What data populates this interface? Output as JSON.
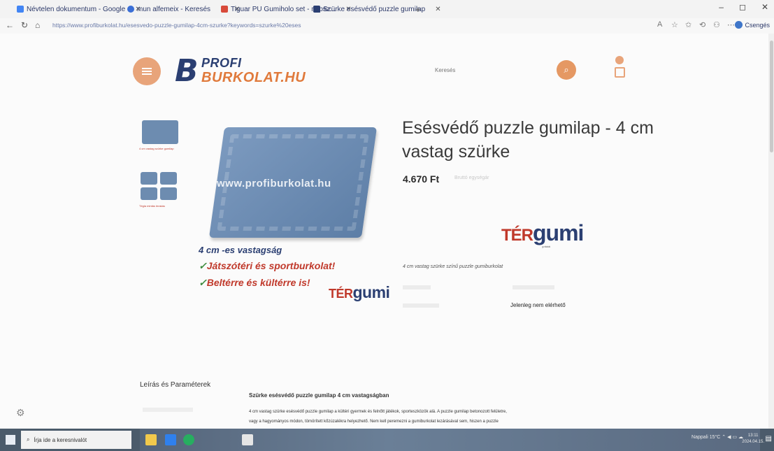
{
  "browser": {
    "tabs": [
      {
        "title": "Névtelen dokumentum - Google",
        "color": "#4285f4"
      },
      {
        "title": "mun alfemeix - Keresés",
        "color": "#3b6fd6"
      },
      {
        "title": "Tiguar PU Gumiholo set - népsz...",
        "color": "#d84a3a"
      },
      {
        "title": "Szürke esésvédő puzzle gumilap",
        "color": "#2b3f72"
      }
    ],
    "new_tab": "+",
    "url": "https://www.profiburkolat.hu/esesvedo-puzzle-gumilap-4cm-szurke?keywords=szurke%20eses",
    "profile_label": "Csengés"
  },
  "site": {
    "logo_line1": "PROFI",
    "logo_line2": "BURKOLAT.HU",
    "search_placeholder": "Keresés"
  },
  "product": {
    "title": "Esésvédő puzzle gumilap - 4 cm vastag szürke",
    "price": "4.670 Ft",
    "price_note": "Bruttó egységár",
    "image_watermark": "www.profiburkolat.hu",
    "image_thickness": "4 cm -es vastagság",
    "image_line1": "Játszótéri és sportburkolat!",
    "image_line2": "Beltérre és kültérre is!",
    "brand_ter": "TÉR",
    "brand_gumi": "gumi",
    "brand_sub": "gumiburkolat",
    "short_description": "4 cm vastag szürke színű puzzle gumiburkolat",
    "availability": "Jelenleg nem elérhető",
    "thumb1_caption": "4 cm vastag szürke gumilap",
    "thumb2_caption": "Tégla mintás lerakás"
  },
  "description": {
    "section_heading": "Leírás és Paraméterek",
    "title": "Szürke esésvédő puzzle gumilap 4 cm vastagságban",
    "body_line1": "4 cm vastag szürke esésvédő puzzle gumilap a kültéri gyermek és felnőtt játékok, sporteszközök alá. A puzzle gumilap betonozott felületre,",
    "body_line2": "vagy a hagyományos módon, tömörített kőzúzalékra helyezhető. Nem kell peremezni a gumiburkolat lezárásával sem, hiszen a puzzle"
  },
  "taskbar": {
    "search_placeholder": "Írja ide a keresnivalót",
    "tray_text": "Nappali 15°C",
    "time": "13:11",
    "date": "2024.04.15."
  }
}
